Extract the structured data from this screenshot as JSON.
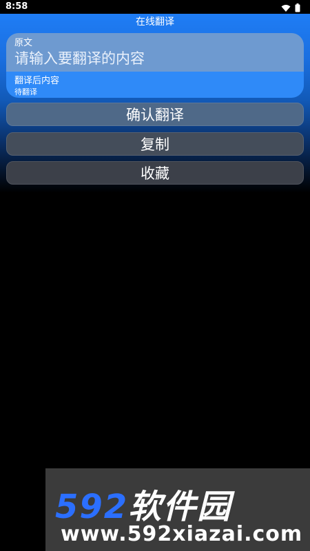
{
  "status_bar": {
    "time": "8:58",
    "icons": [
      "wifi-icon",
      "battery-icon"
    ]
  },
  "app": {
    "title": "在线翻译"
  },
  "source": {
    "label": "原文",
    "placeholder": "请输入要翻译的内容"
  },
  "result": {
    "label": "翻译后内容",
    "text": "待翻译"
  },
  "buttons": {
    "confirm": "确认翻译",
    "copy": "复制",
    "favorite": "收藏"
  },
  "watermark": {
    "logo_number": "592",
    "logo_text": "软件园",
    "url": "www.592xiazai.com"
  },
  "colors": {
    "accent": "#1f7df5",
    "card": "#2f8af8",
    "background": "#000000",
    "brand": "#2b6fff"
  }
}
